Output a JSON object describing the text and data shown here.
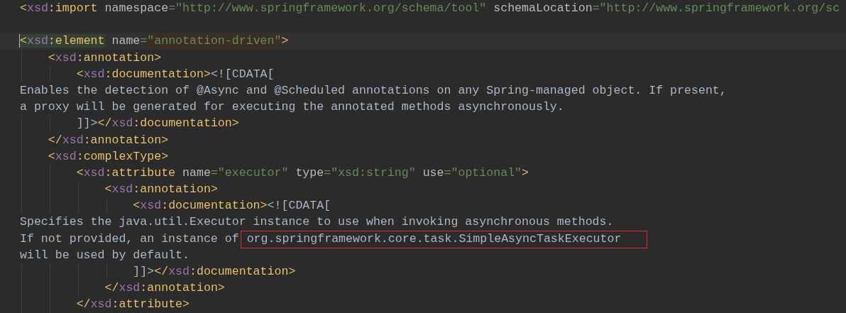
{
  "lines": [
    {
      "current": false,
      "tokens": [
        {
          "kind": "bracket",
          "text": "<"
        },
        {
          "kind": "ns",
          "text": "xsd"
        },
        {
          "kind": "tag",
          "text": ":import"
        },
        {
          "kind": "attr",
          "text": " namespace"
        },
        {
          "kind": "value",
          "text": "=\"http://www.springframework.org/schema/tool\""
        },
        {
          "kind": "attr",
          "text": " schemaLocation"
        },
        {
          "kind": "value",
          "text": "=\"http://www.springframework.org/sc"
        }
      ]
    },
    {
      "current": false
    },
    {
      "current": true,
      "tokens": [
        {
          "kind": "bracket",
          "text": "<",
          "highlighted": true
        },
        {
          "kind": "ns",
          "text": "xsd",
          "highlighted": true
        },
        {
          "kind": "tag",
          "text": ":element",
          "highlighted": true
        },
        {
          "kind": "attr",
          "text": " name"
        },
        {
          "kind": "value",
          "text": "="
        },
        {
          "kind": "value",
          "text": "\"annotation-driven\"",
          "highlighted": true
        },
        {
          "kind": "bracket",
          "text": ">"
        }
      ]
    },
    {
      "current": false,
      "tokens": [
        {
          "kind": "bracket",
          "text": "    <"
        },
        {
          "kind": "ns",
          "text": "xsd"
        },
        {
          "kind": "tag",
          "text": ":annotation"
        },
        {
          "kind": "bracket",
          "text": ">"
        }
      ]
    },
    {
      "current": false,
      "tokens": [
        {
          "kind": "bracket",
          "text": "        <"
        },
        {
          "kind": "ns",
          "text": "xsd"
        },
        {
          "kind": "tag",
          "text": ":documentation"
        },
        {
          "kind": "bracket",
          "text": ">"
        },
        {
          "kind": "text",
          "text": "<![CDATA["
        }
      ]
    },
    {
      "current": false,
      "tokens": [
        {
          "kind": "text",
          "text": "Enables the detection of @Async and @Scheduled annotations on any Spring-managed object. If present,"
        }
      ]
    },
    {
      "current": false,
      "tokens": [
        {
          "kind": "text",
          "text": "a proxy will be generated for executing the annotated methods asynchronously."
        }
      ]
    },
    {
      "current": false,
      "tokens": [
        {
          "kind": "text",
          "text": "        ]]>"
        },
        {
          "kind": "bracket",
          "text": "</"
        },
        {
          "kind": "ns",
          "text": "xsd"
        },
        {
          "kind": "tag",
          "text": ":documentation"
        },
        {
          "kind": "bracket",
          "text": ">"
        }
      ]
    },
    {
      "current": false,
      "tokens": [
        {
          "kind": "bracket",
          "text": "    </"
        },
        {
          "kind": "ns",
          "text": "xsd"
        },
        {
          "kind": "tag",
          "text": ":annotation"
        },
        {
          "kind": "bracket",
          "text": ">"
        }
      ]
    },
    {
      "current": false,
      "tokens": [
        {
          "kind": "bracket",
          "text": "    <"
        },
        {
          "kind": "ns",
          "text": "xsd"
        },
        {
          "kind": "tag",
          "text": ":complexType"
        },
        {
          "kind": "bracket",
          "text": ">"
        }
      ]
    },
    {
      "current": false,
      "tokens": [
        {
          "kind": "bracket",
          "text": "        <"
        },
        {
          "kind": "ns",
          "text": "xsd"
        },
        {
          "kind": "tag",
          "text": ":attribute"
        },
        {
          "kind": "attr",
          "text": " name"
        },
        {
          "kind": "value",
          "text": "=\"executor\""
        },
        {
          "kind": "attr",
          "text": " type"
        },
        {
          "kind": "value",
          "text": "=\"xsd:string\""
        },
        {
          "kind": "attr",
          "text": " use"
        },
        {
          "kind": "value",
          "text": "=\"optional\""
        },
        {
          "kind": "bracket",
          "text": ">"
        }
      ]
    },
    {
      "current": false,
      "tokens": [
        {
          "kind": "bracket",
          "text": "            <"
        },
        {
          "kind": "ns",
          "text": "xsd"
        },
        {
          "kind": "tag",
          "text": ":annotation"
        },
        {
          "kind": "bracket",
          "text": ">"
        }
      ]
    },
    {
      "current": false,
      "tokens": [
        {
          "kind": "bracket",
          "text": "                <"
        },
        {
          "kind": "ns",
          "text": "xsd"
        },
        {
          "kind": "tag",
          "text": ":documentation"
        },
        {
          "kind": "bracket",
          "text": ">"
        },
        {
          "kind": "text",
          "text": "<![CDATA["
        }
      ]
    },
    {
      "current": false,
      "tokens": [
        {
          "kind": "text",
          "text": "Specifies the java.util.Executor instance to use when invoking asynchronous methods."
        }
      ]
    },
    {
      "current": false,
      "tokens": [
        {
          "kind": "text",
          "text": "If not provided, an instance of "
        },
        {
          "kind": "text",
          "text": "org.springframework.core.task.SimpleAsyncTaskExecutor",
          "boxed": true
        }
      ]
    },
    {
      "current": false,
      "tokens": [
        {
          "kind": "text",
          "text": "will be used by default."
        }
      ]
    },
    {
      "current": false,
      "tokens": [
        {
          "kind": "text",
          "text": "                ]]>"
        },
        {
          "kind": "bracket",
          "text": "</"
        },
        {
          "kind": "ns",
          "text": "xsd"
        },
        {
          "kind": "tag",
          "text": ":documentation"
        },
        {
          "kind": "bracket",
          "text": ">"
        }
      ]
    },
    {
      "current": false,
      "tokens": [
        {
          "kind": "bracket",
          "text": "            </"
        },
        {
          "kind": "ns",
          "text": "xsd"
        },
        {
          "kind": "tag",
          "text": ":annotation"
        },
        {
          "kind": "bracket",
          "text": ">"
        }
      ]
    },
    {
      "current": false,
      "tokens": [
        {
          "kind": "bracket",
          "text": "        </"
        },
        {
          "kind": "ns",
          "text": "xsd"
        },
        {
          "kind": "tag",
          "text": ":attribute"
        },
        {
          "kind": "bracket",
          "text": ">"
        }
      ]
    }
  ]
}
